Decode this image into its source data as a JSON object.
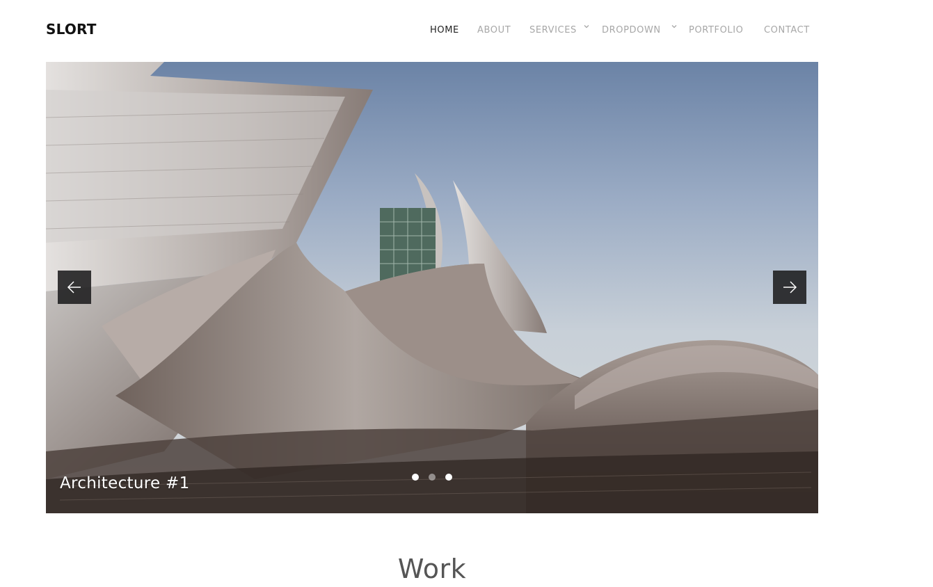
{
  "brand": {
    "logo": "SLORT"
  },
  "nav": {
    "items": [
      {
        "label": "HOME",
        "active": true,
        "has_dropdown": false
      },
      {
        "label": "ABOUT",
        "active": false,
        "has_dropdown": false
      },
      {
        "label": "SERVICES",
        "active": false,
        "has_dropdown": true
      },
      {
        "label": "DROPDOWN",
        "active": false,
        "has_dropdown": true
      },
      {
        "label": "PORTFOLIO",
        "active": false,
        "has_dropdown": false
      },
      {
        "label": "CONTACT",
        "active": false,
        "has_dropdown": false
      }
    ],
    "icons": {
      "dropdown": "chevron-down-icon"
    }
  },
  "slider": {
    "caption": "Architecture #1",
    "slides_count": 3,
    "active_slide": 1,
    "prev_icon": "arrow-left-icon",
    "next_icon": "arrow-right-icon"
  },
  "section": {
    "title": "Work"
  },
  "colors": {
    "nav_active": "#222222",
    "nav_inactive": "#a7a7a7",
    "arrow_bg": "#1c1c1e"
  }
}
